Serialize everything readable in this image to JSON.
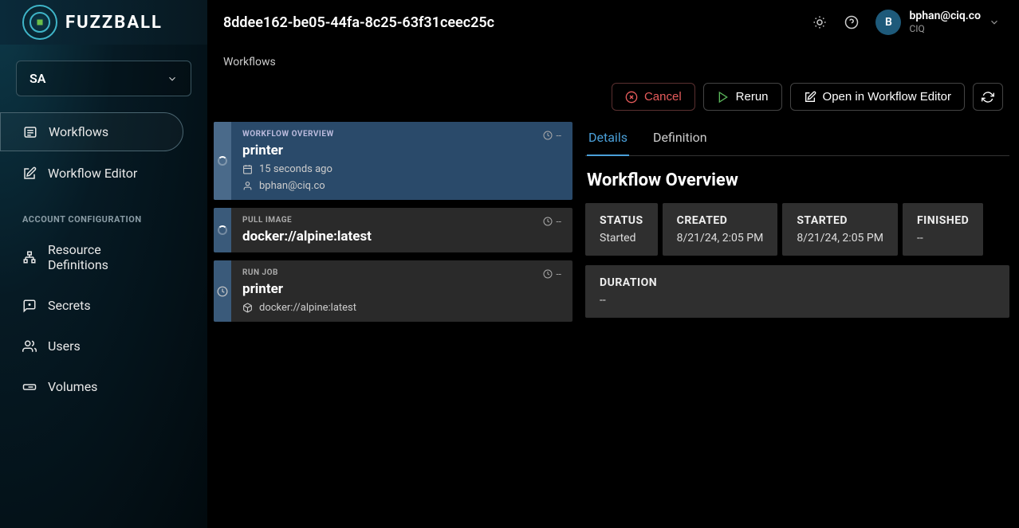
{
  "brand": "FUZZBALL",
  "header": {
    "title": "8ddee162-be05-44fa-8c25-63f31ceec25c",
    "user": {
      "initial": "B",
      "email": "bphan@ciq.co",
      "org": "CIQ"
    }
  },
  "sidebar": {
    "org_label": "SA",
    "items": [
      {
        "label": "Workflows",
        "icon": "list"
      },
      {
        "label": "Workflow Editor",
        "icon": "pencil"
      }
    ],
    "section_label": "ACCOUNT CONFIGURATION",
    "config_items": [
      {
        "label": "Resource Definitions",
        "icon": "sitemap"
      },
      {
        "label": "Secrets",
        "icon": "message-lock"
      },
      {
        "label": "Users",
        "icon": "users"
      },
      {
        "label": "Volumes",
        "icon": "drive"
      }
    ]
  },
  "breadcrumb": "Workflows",
  "actions": {
    "cancel": "Cancel",
    "rerun": "Rerun",
    "open_editor": "Open in Workflow Editor"
  },
  "cards": [
    {
      "type": "WORKFLOW OVERVIEW",
      "title": "printer",
      "duration": "--",
      "meta1_icon": "calendar",
      "meta1": "15 seconds ago",
      "meta2_icon": "user",
      "meta2": "bphan@ciq.co",
      "status_icon": "spinner"
    },
    {
      "type": "PULL IMAGE",
      "title": "docker://alpine:latest",
      "duration": "--",
      "status_icon": "spinner"
    },
    {
      "type": "RUN JOB",
      "title": "printer",
      "duration": "--",
      "meta1_icon": "cube",
      "meta1": "docker://alpine:latest",
      "status_icon": "clock"
    }
  ],
  "tabs": {
    "details": "Details",
    "definition": "Definition"
  },
  "details": {
    "heading": "Workflow Overview",
    "stats": {
      "status_label": "STATUS",
      "status_value": "Started",
      "created_label": "CREATED",
      "created_value": "8/21/24, 2:05 PM",
      "started_label": "STARTED",
      "started_value": "8/21/24, 2:05 PM",
      "finished_label": "FINISHED",
      "finished_value": "--",
      "duration_label": "DURATION",
      "duration_value": "--"
    }
  }
}
